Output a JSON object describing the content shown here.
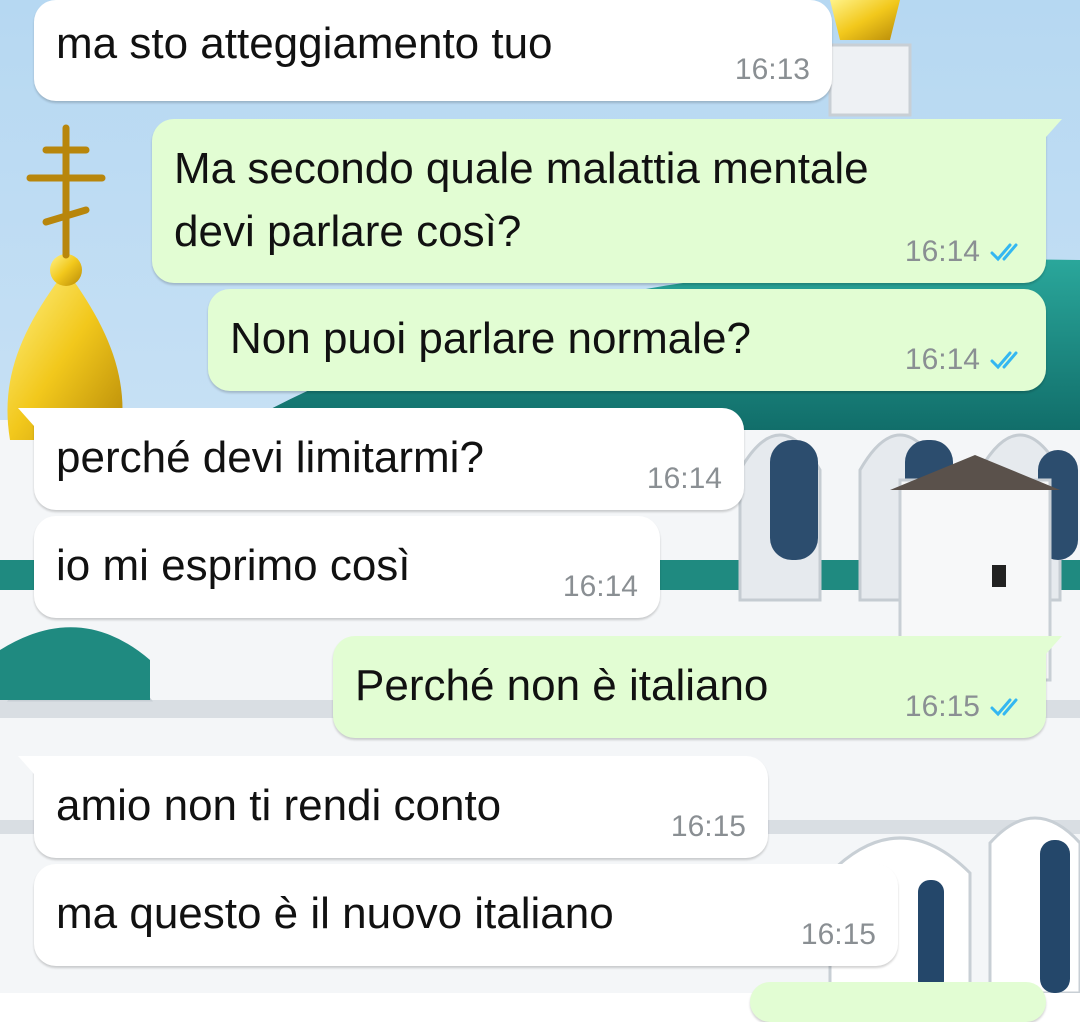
{
  "messages": [
    {
      "direction": "incoming",
      "text": "ma sto atteggiamento tuo",
      "time": "16:13",
      "read_receipt": false
    },
    {
      "direction": "outgoing",
      "text": "Ma secondo quale malattia mentale\ndevi parlare così?",
      "time": "16:14",
      "read_receipt": true
    },
    {
      "direction": "outgoing",
      "text": "Non puoi parlare normale?",
      "time": "16:14",
      "read_receipt": true
    },
    {
      "direction": "incoming",
      "text": "perché devi limitarmi?",
      "time": "16:14",
      "read_receipt": false
    },
    {
      "direction": "incoming",
      "text": "io mi esprimo così",
      "time": "16:14",
      "read_receipt": false
    },
    {
      "direction": "outgoing",
      "text": "Perché non è italiano",
      "time": "16:15",
      "read_receipt": true
    },
    {
      "direction": "incoming",
      "text": "amio non ti rendi conto",
      "time": "16:15",
      "read_receipt": false
    },
    {
      "direction": "incoming",
      "text": "ma questo è il nuovo italiano",
      "time": "16:15",
      "read_receipt": false
    }
  ],
  "colors": {
    "incoming_bubble": "#ffffff",
    "outgoing_bubble": "#e2fdd3",
    "timestamp": "#8a8f93",
    "read_ticks": "#34b7f1"
  },
  "icons": {
    "read_receipt": "double-check-icon"
  },
  "wallpaper": "orthodox-church-with-golden-dome"
}
